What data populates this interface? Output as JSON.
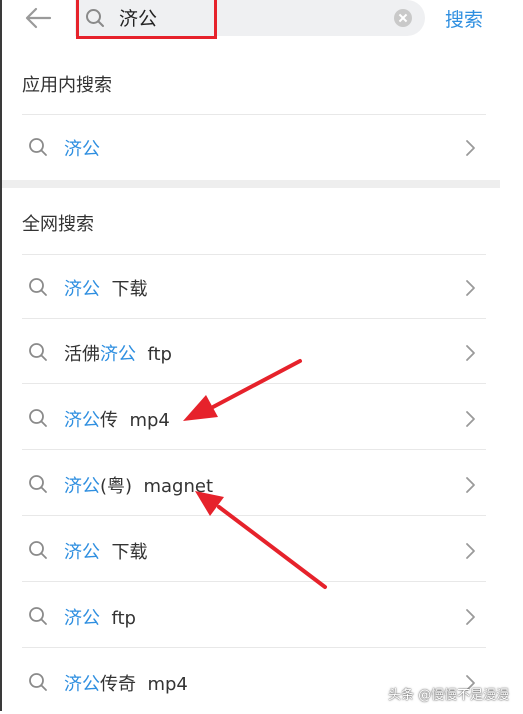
{
  "header": {
    "search_value": "济公",
    "search_button": "搜索"
  },
  "in_app": {
    "title": "应用内搜索",
    "items": [
      {
        "hl": "济公",
        "rest": ""
      }
    ]
  },
  "web": {
    "title": "全网搜索",
    "items": [
      {
        "pre": "",
        "hl": "济公",
        "rest": "  下载"
      },
      {
        "pre": "活佛",
        "hl": "济公",
        "rest": "  ftp"
      },
      {
        "pre": "",
        "hl": "济公",
        "rest": "传  mp4"
      },
      {
        "pre": "",
        "hl": "济公",
        "rest": "(粤)  magnet"
      },
      {
        "pre": "",
        "hl": "济公",
        "rest": "  下载"
      },
      {
        "pre": "",
        "hl": "济公",
        "rest": "  ftp"
      },
      {
        "pre": "",
        "hl": "济公",
        "rest": "传奇  mp4"
      }
    ]
  },
  "watermark": "头条 @慢慢不是漫漫",
  "colors": {
    "accent": "#2f8fe0",
    "annotation_red": "#e6222b"
  }
}
